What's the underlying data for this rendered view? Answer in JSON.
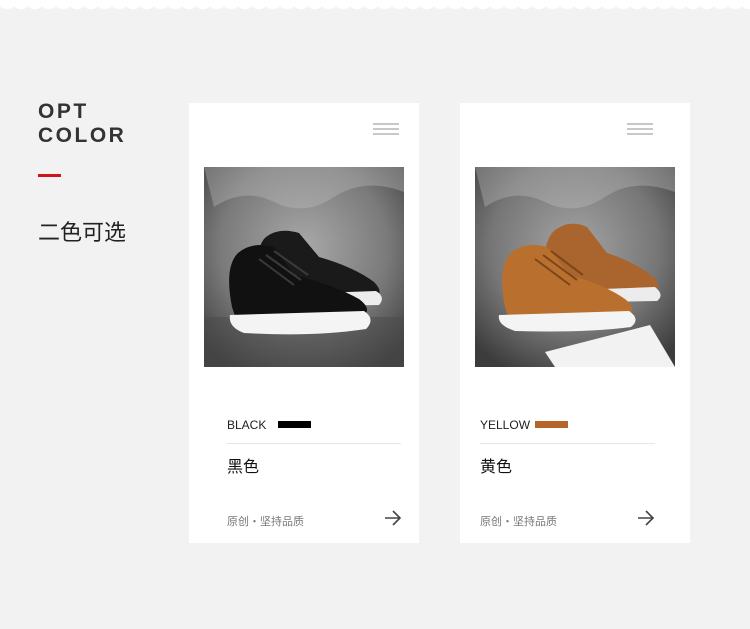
{
  "section": {
    "title_line1": "OPT",
    "title_line2": "COLOR",
    "subtitle": "二色可选",
    "accent_color": "#d0121b"
  },
  "cards": [
    {
      "color_name": "BLACK",
      "swatch_color": "#000000",
      "cn_name": "黑色",
      "tagline": "原创・坚持品质",
      "image": "black high-top sneaker photo",
      "menu_icon": "menu-lines-icon",
      "arrow_icon": "arrow-right-icon"
    },
    {
      "color_name": "YELLOW",
      "swatch_color": "#b5652a",
      "cn_name": "黄色",
      "tagline": "原创・坚持品质",
      "image": "brown high-top sneaker photo",
      "menu_icon": "menu-lines-icon",
      "arrow_icon": "arrow-right-icon"
    }
  ]
}
